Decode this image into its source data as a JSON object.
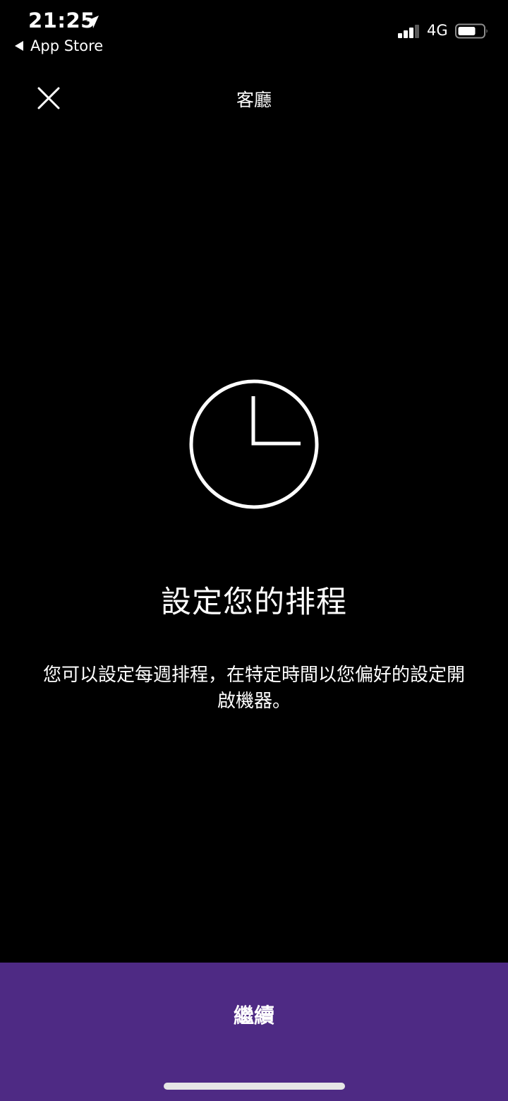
{
  "status_bar": {
    "time": "21:25",
    "back_app_label": "App Store",
    "network": "4G",
    "icons": {
      "location": "location-arrow-icon",
      "signal": "cellular-signal-icon",
      "battery": "battery-icon",
      "back": "back-chevron-icon"
    }
  },
  "nav": {
    "title": "客廳",
    "close_icon": "close-icon"
  },
  "content": {
    "illustration_icon": "clock-icon",
    "headline": "設定您的排程",
    "description": "您可以設定每週排程，在特定時間以您偏好的設定開啟機器。"
  },
  "footer": {
    "continue_label": "繼續"
  },
  "colors": {
    "background": "#000000",
    "text": "#ffffff",
    "accent": "#4e2a84"
  }
}
